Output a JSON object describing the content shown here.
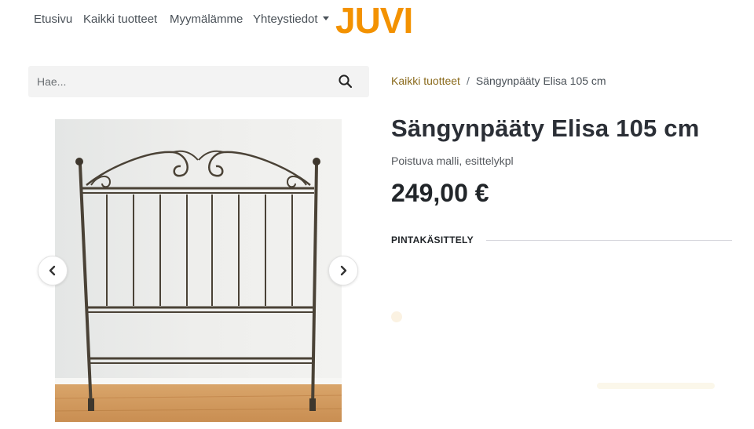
{
  "nav": {
    "items": [
      "Etusivu",
      "Kaikki tuotteet",
      "Myymälämme",
      "Yhteystiedot"
    ],
    "logo_text": "JUVI"
  },
  "colors": {
    "brand": "#f39200",
    "link": "#8a6a1c",
    "search_bg": "#f3f3f3"
  },
  "search": {
    "placeholder": "Hae...",
    "icon": "search-icon"
  },
  "gallery": {
    "image": "wrought-iron headboard",
    "prev_icon": "chevron-left-icon",
    "next_icon": "chevron-right-icon"
  },
  "breadcrumb": {
    "parent": "Kaikki tuotteet",
    "separator": "/",
    "current": "Sängynpääty Elisa 105 cm"
  },
  "product": {
    "title": "Sängynpääty Elisa 105 cm",
    "subtitle": "Poistuva malli, esittelykpl",
    "price": "249,00 €",
    "attribute_label": "PINTAKÄSITTELY"
  }
}
